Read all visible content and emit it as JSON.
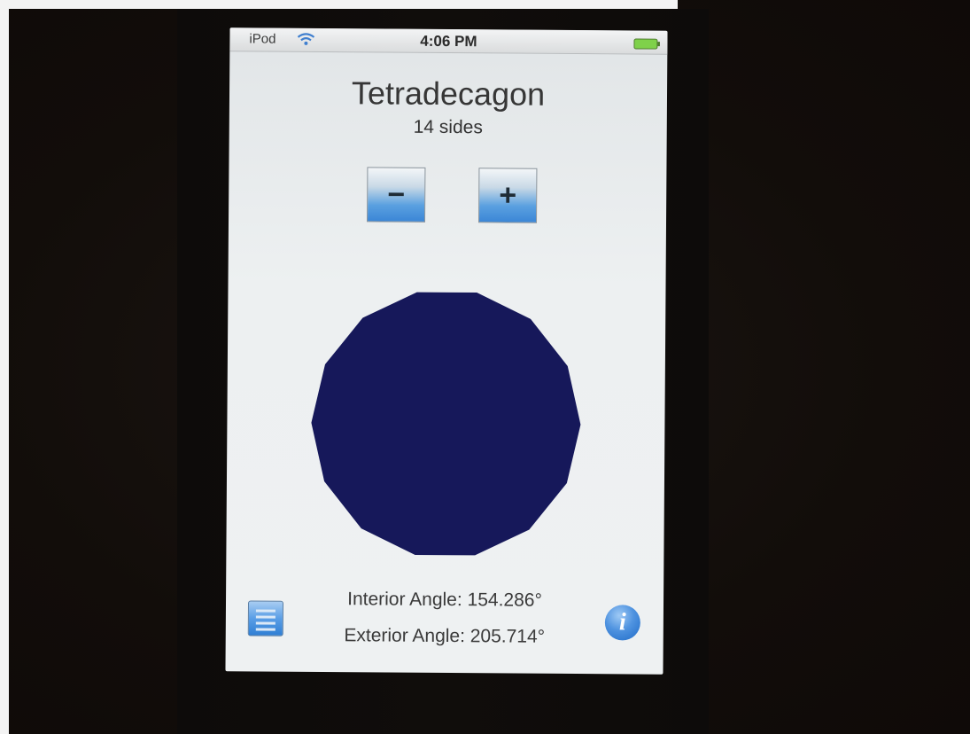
{
  "status_bar": {
    "carrier": "iPod",
    "time": "4:06 PM"
  },
  "polygon": {
    "name": "Tetradecagon",
    "sides_label": "14 sides",
    "sides": 14,
    "fill_color": "#16185a"
  },
  "controls": {
    "decrement_label": "−",
    "increment_label": "+"
  },
  "angles": {
    "interior": "Interior Angle: 154.286°",
    "exterior": "Exterior Angle: 205.714°"
  },
  "icons": {
    "list": "list-icon",
    "info": "info-icon",
    "wifi": "wifi-icon",
    "battery": "battery-icon"
  },
  "colors": {
    "accent": "#3b86d6",
    "screen_bg": "#eef1f2"
  }
}
